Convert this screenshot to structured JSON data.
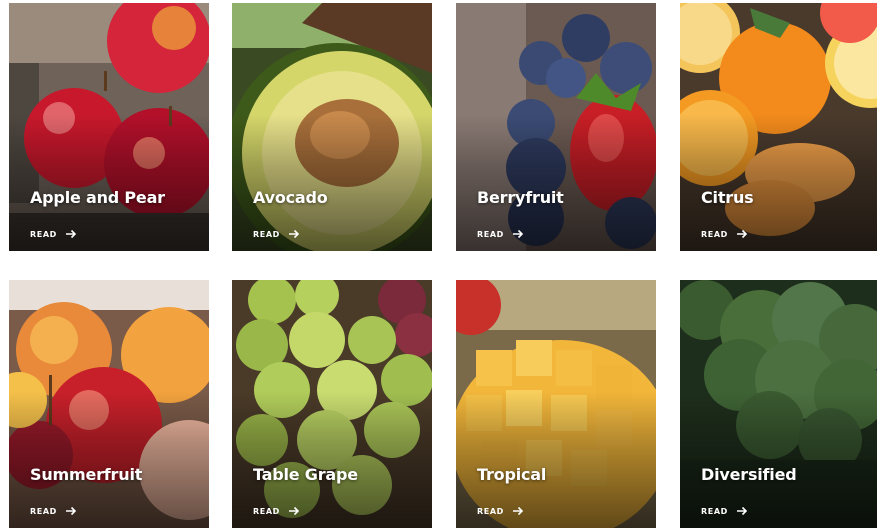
{
  "products": [
    {
      "title": "Apple and Pear",
      "link": "READ",
      "icon": "arrow-right-icon"
    },
    {
      "title": "Avocado",
      "link": "READ",
      "icon": "arrow-right-icon"
    },
    {
      "title": "Berryfruit",
      "link": "READ",
      "icon": "arrow-right-icon"
    },
    {
      "title": "Citrus",
      "link": "READ",
      "icon": "arrow-right-icon"
    },
    {
      "title": "Summerfruit",
      "link": "READ",
      "icon": "arrow-right-icon"
    },
    {
      "title": "Table Grape",
      "link": "READ",
      "icon": "arrow-right-icon"
    },
    {
      "title": "Tropical",
      "link": "READ",
      "icon": "arrow-right-icon"
    },
    {
      "title": "Diversified",
      "link": "READ",
      "icon": "arrow-right-icon"
    }
  ],
  "colors": {
    "text": "#ffffff",
    "background": "#ffffff"
  }
}
